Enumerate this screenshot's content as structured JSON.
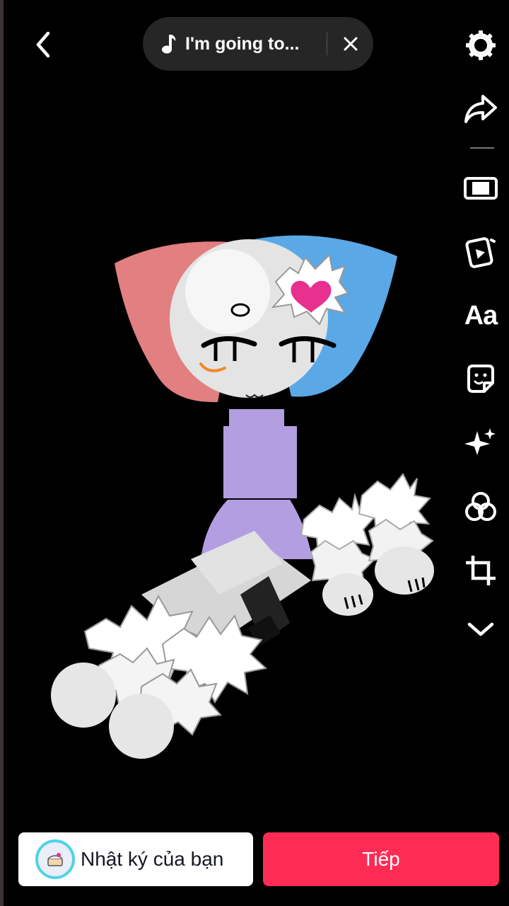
{
  "header": {
    "sound_title": "I'm going to...",
    "icons": {
      "back": "chevron-left-icon",
      "music": "music-note-icon",
      "close": "close-icon"
    }
  },
  "toolbar": {
    "items": [
      {
        "id": "settings",
        "icon": "gear-icon"
      },
      {
        "id": "share",
        "icon": "share-arrow-icon"
      },
      {
        "id": "aspect",
        "icon": "aspect-ratio-icon"
      },
      {
        "id": "templates",
        "icon": "video-template-icon"
      },
      {
        "id": "text",
        "icon": "text-icon",
        "label": "Aa"
      },
      {
        "id": "stickers",
        "icon": "sticker-icon"
      },
      {
        "id": "effects",
        "icon": "sparkle-icon"
      },
      {
        "id": "filters",
        "icon": "filters-icon"
      },
      {
        "id": "crop",
        "icon": "crop-icon"
      },
      {
        "id": "more",
        "icon": "chevron-down-icon"
      }
    ]
  },
  "footer": {
    "diary_label": "Nhật ký của bạn",
    "next_label": "Tiếp"
  },
  "colors": {
    "next_button": "#fe2c55",
    "pill_bg": "#262626",
    "avatar_ring": "#4fd3e6"
  }
}
